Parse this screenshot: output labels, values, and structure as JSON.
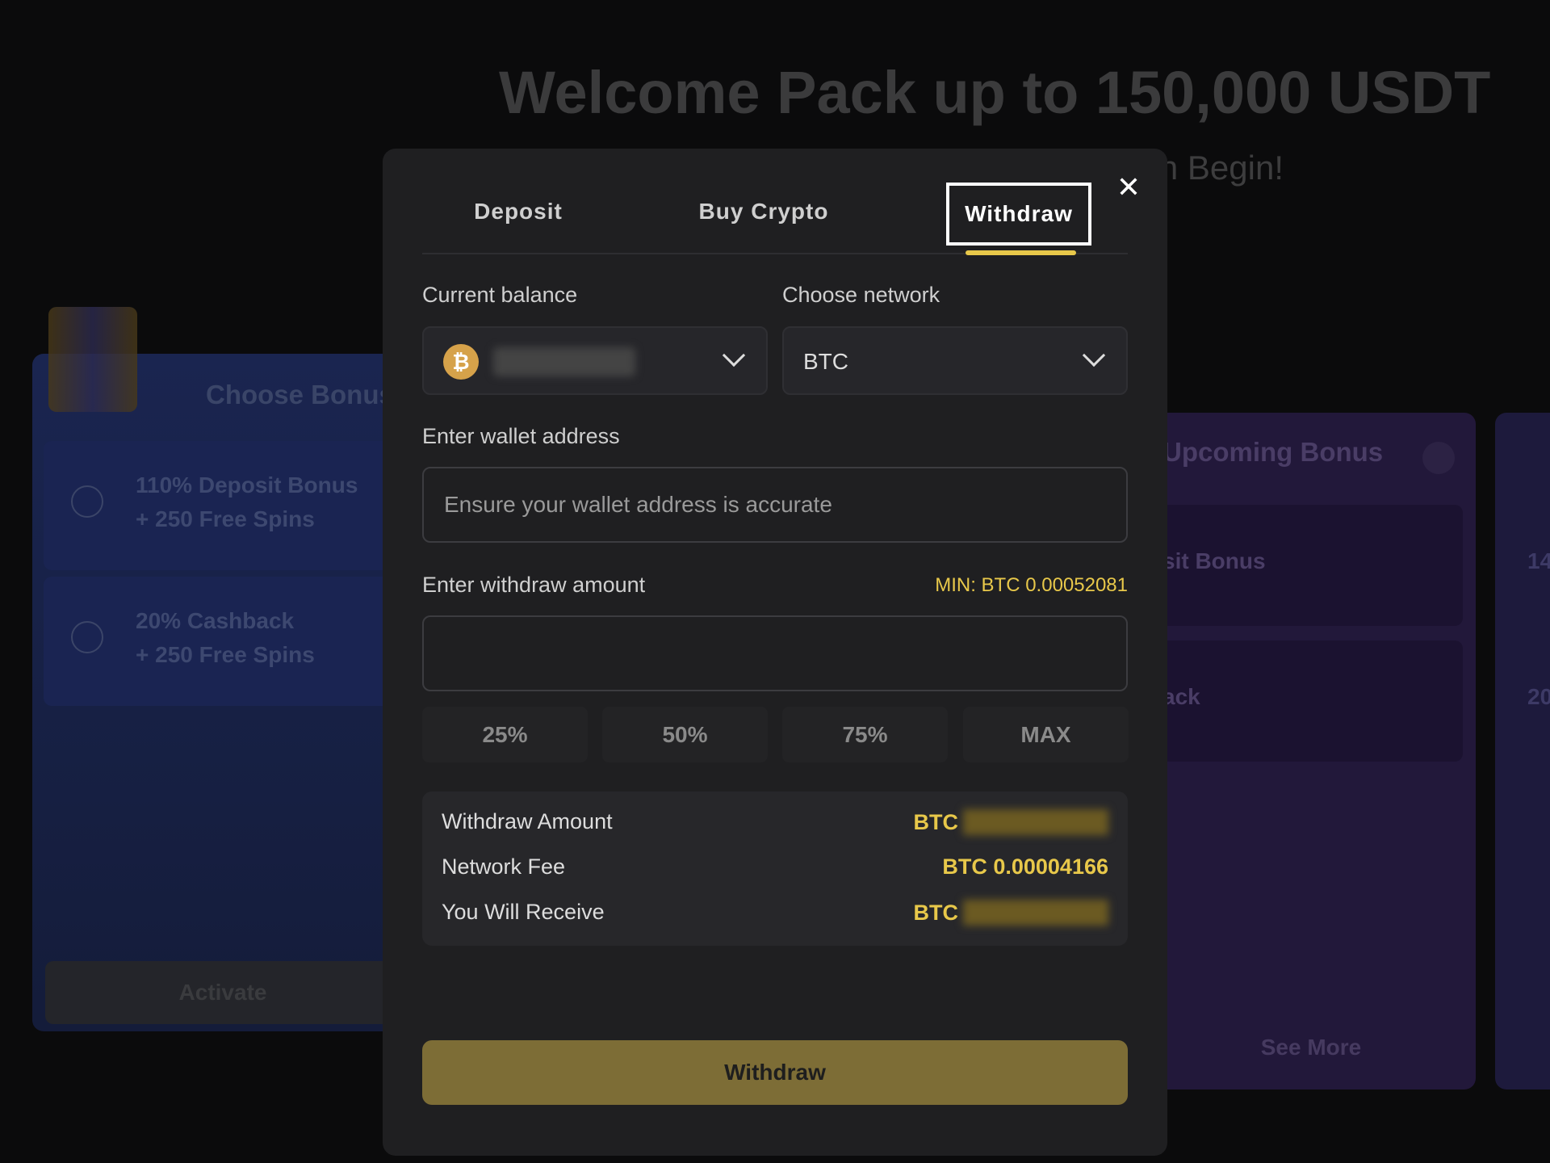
{
  "background": {
    "hero_title": "Welcome Pack up to 150,000 USDT",
    "hero_subtitle": "n Begin!",
    "left_card": {
      "title": "Choose Bonus",
      "options": [
        "110% Deposit Bonus\n+ 250 Free Spins",
        "20% Cashback\n+ 250 Free Spins"
      ],
      "activate_label": "Activate"
    },
    "right_card": {
      "title": "Upcoming Bonus",
      "items": [
        "sit Bonus",
        "ack"
      ],
      "see_more": "See More"
    },
    "far_card": {
      "items": [
        "14",
        "20"
      ]
    }
  },
  "modal": {
    "tabs": [
      {
        "label": "Deposit"
      },
      {
        "label": "Buy Crypto"
      },
      {
        "label": "Withdraw",
        "active": true
      }
    ],
    "close_icon": "close-x",
    "current_balance_label": "Current balance",
    "balance_coin_icon": "bitcoin-icon",
    "choose_network_label": "Choose network",
    "network_value": "BTC",
    "wallet_label": "Enter wallet address",
    "wallet_placeholder": "Ensure your wallet address is accurate",
    "amount_label": "Enter withdraw amount",
    "min_text": "MIN: BTC 0.00052081",
    "amount_value": "",
    "pct_buttons": [
      "25%",
      "50%",
      "75%",
      "MAX"
    ],
    "summary": {
      "withdraw_amount_label": "Withdraw Amount",
      "withdraw_amount_currency": "BTC",
      "network_fee_label": "Network Fee",
      "network_fee_value": "BTC 0.00004166",
      "receive_label": "You Will Receive",
      "receive_currency": "BTC"
    },
    "submit_label": "Withdraw"
  },
  "colors": {
    "accent": "#e8c84a",
    "button": "#7d6d36",
    "modal_bg": "#1f1f21"
  }
}
